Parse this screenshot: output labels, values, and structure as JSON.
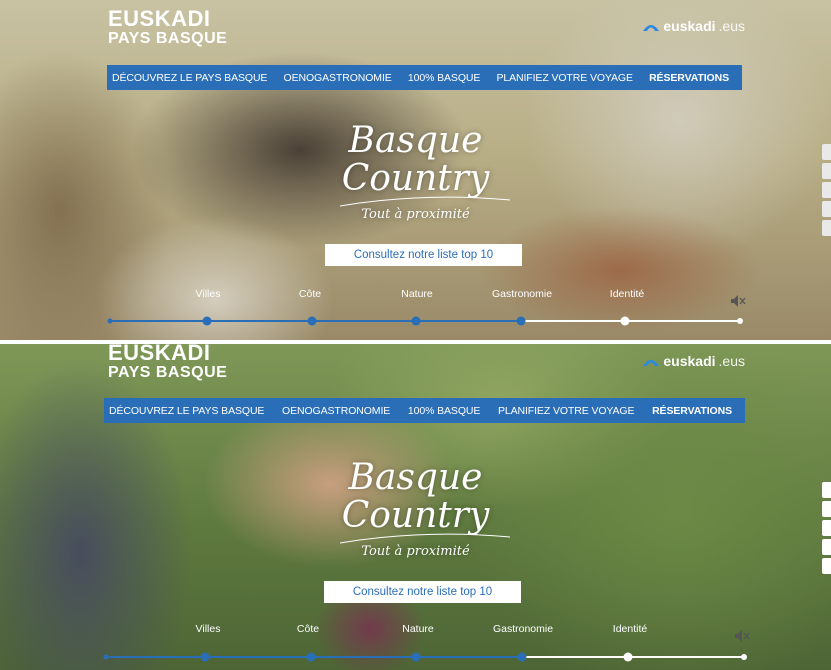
{
  "brand": {
    "line1": "EUSKADI",
    "line2": "PAYS BASQUE"
  },
  "external_link": {
    "bold": "euskadi",
    "suffix": ".eus"
  },
  "nav": [
    {
      "label": "DÉCOUVREZ LE PAYS BASQUE"
    },
    {
      "label": "OENOGASTRONOMIE"
    },
    {
      "label": "100% BASQUE"
    },
    {
      "label": "PLANIFIEZ VOTRE VOYAGE"
    },
    {
      "label": "RÉSERVATIONS"
    }
  ],
  "hero": {
    "line1": "Basque",
    "line2": "Country",
    "tagline": "Tout à proximité"
  },
  "cta": {
    "label": "Consultez notre liste top 10"
  },
  "timeline": [
    "Villes",
    "Côte",
    "Nature",
    "Gastronomie",
    "Identité"
  ],
  "colors": {
    "nav_bg": "#2a6eb7",
    "timeline_active": "#2a6eb7",
    "timeline_inactive": "#ffffff"
  },
  "icons": {
    "external_logo": "euskadi-arc-icon",
    "mute": "speaker-mute-icon"
  },
  "panels": [
    {
      "id": "top",
      "progress_active_dots": 5
    },
    {
      "id": "bottom",
      "progress_active_dots": 5
    }
  ]
}
